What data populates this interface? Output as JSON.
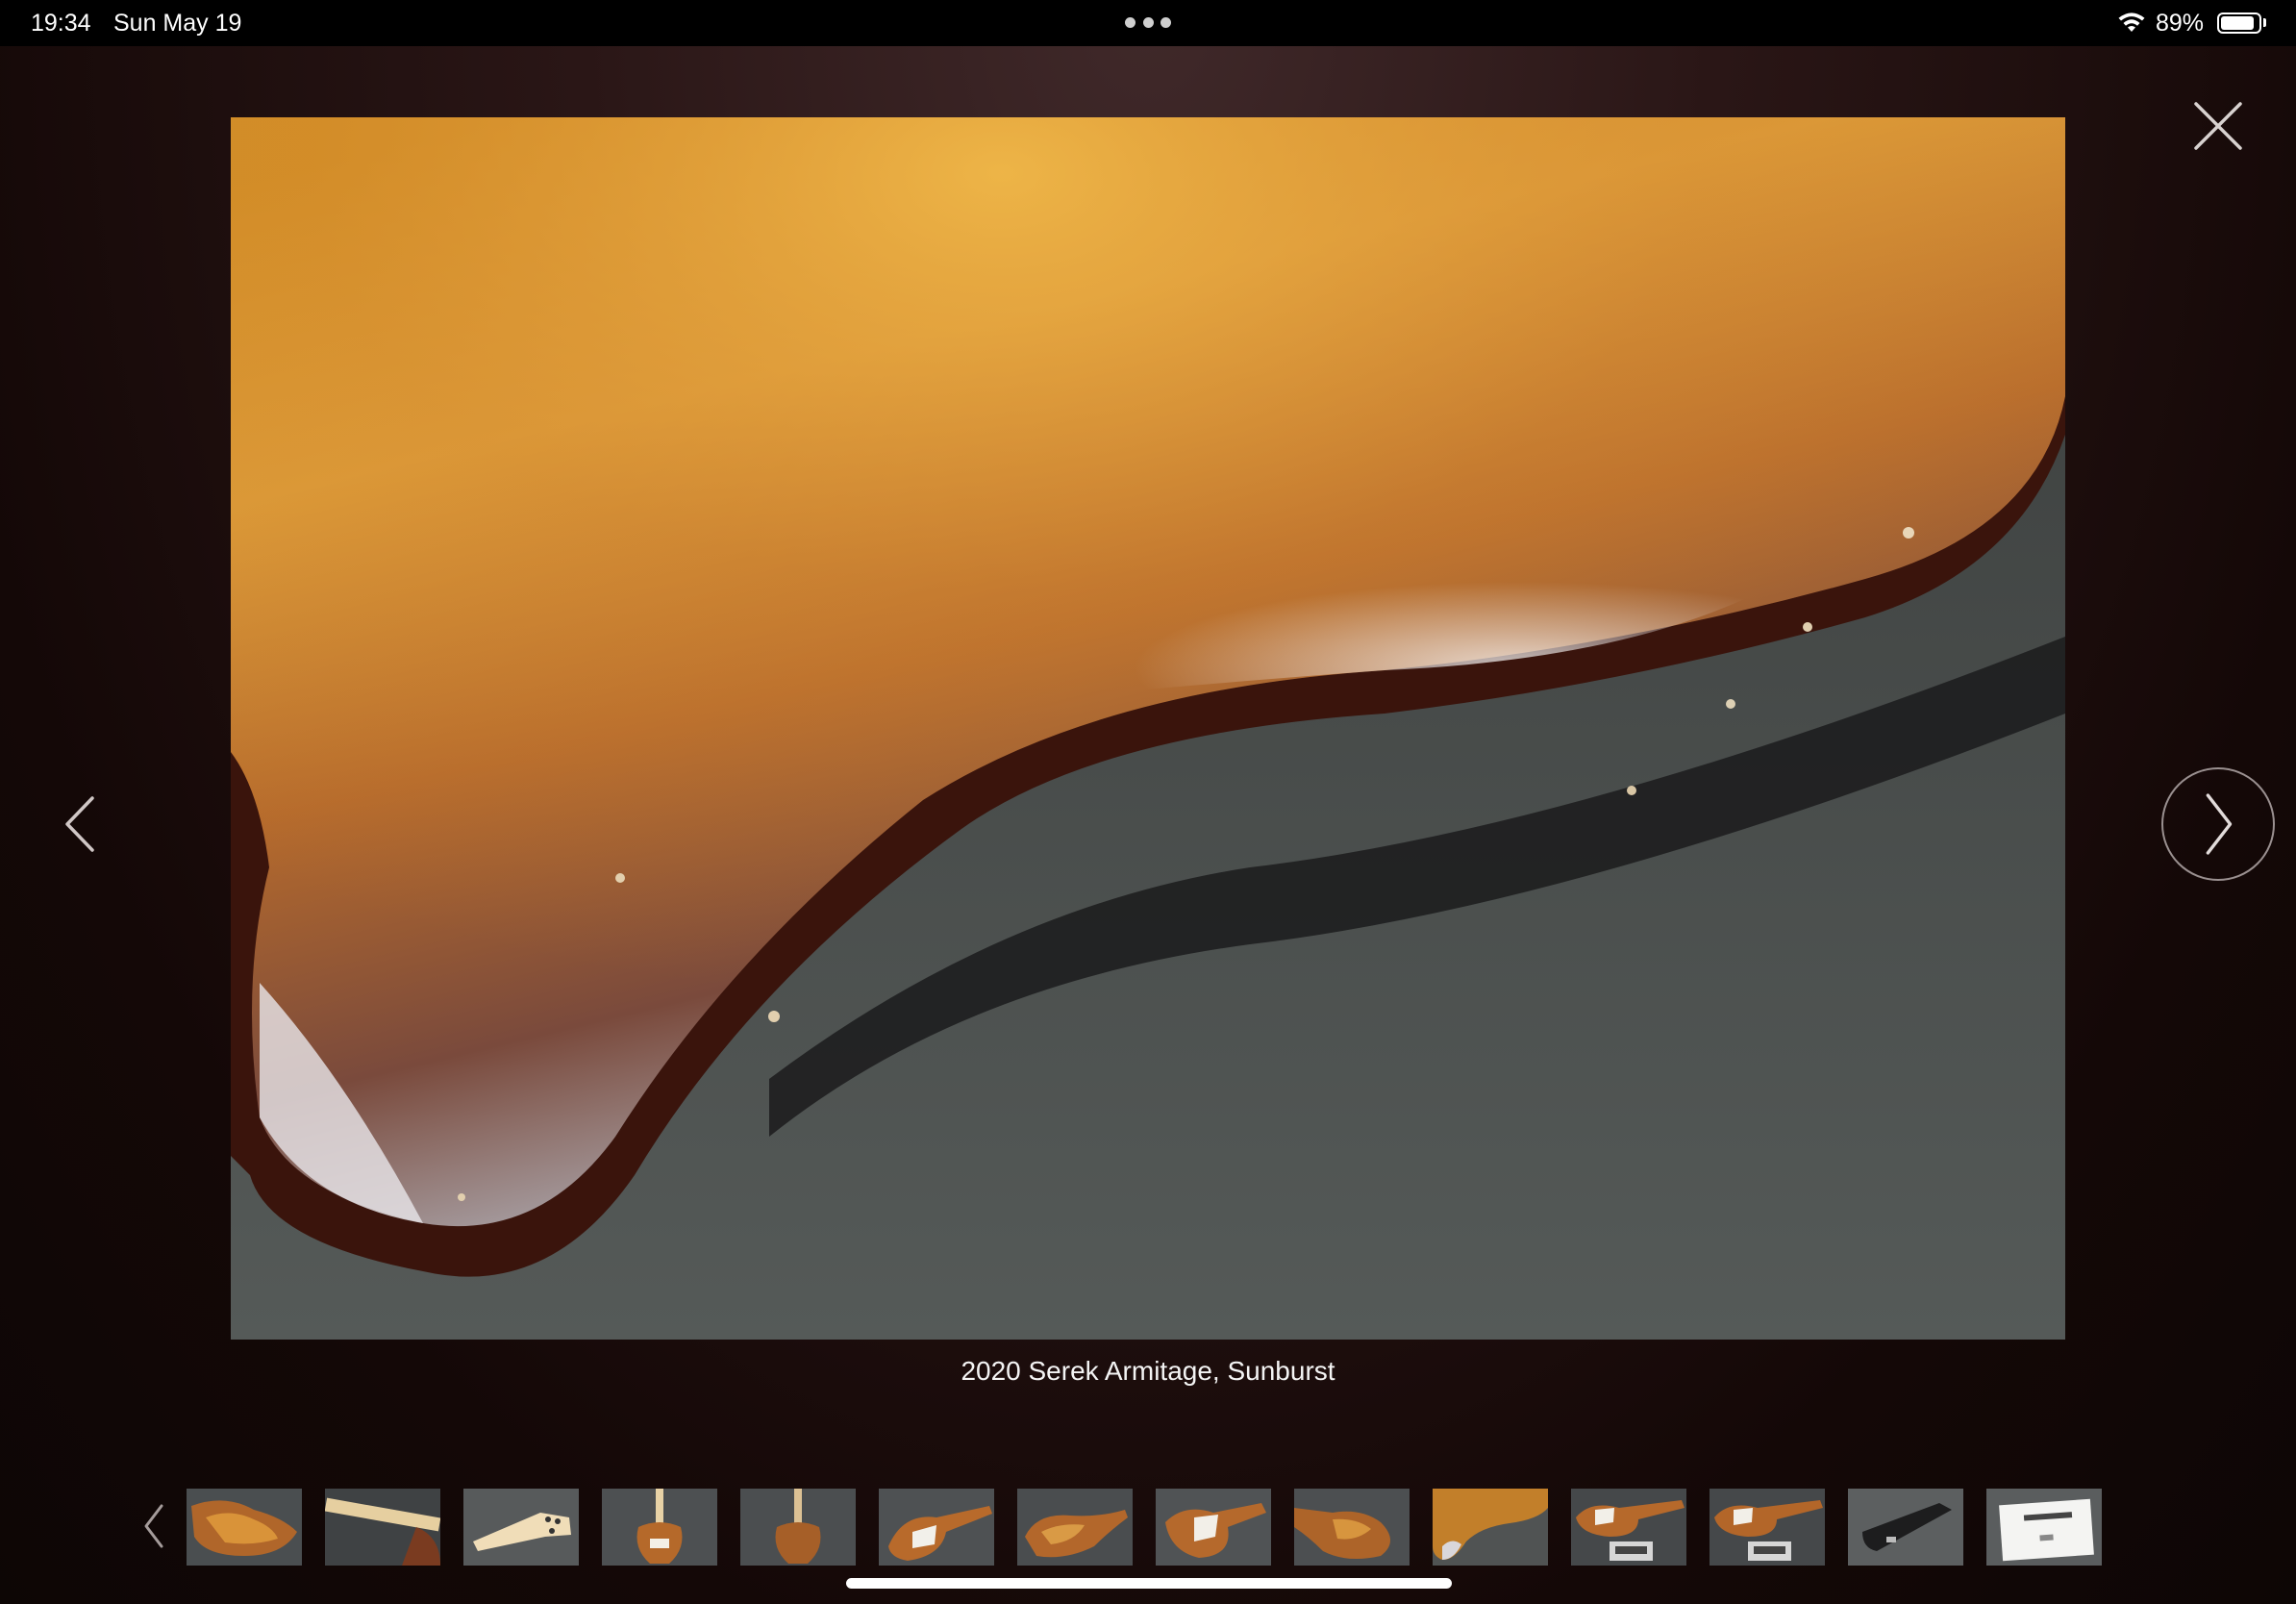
{
  "status_bar": {
    "time": "19:34",
    "date": "Sun May 19",
    "battery_text": "89%",
    "battery_level": 0.89
  },
  "viewer": {
    "caption": "2020 Serek Armitage, Sunburst",
    "close_icon": "close-icon",
    "prev_icon": "chevron-left-icon",
    "next_icon": "chevron-right-icon"
  },
  "thumbnails": {
    "count": 14,
    "selected_index": 9,
    "items": [
      {
        "kind": "body-back"
      },
      {
        "kind": "neck-back"
      },
      {
        "kind": "headstock"
      },
      {
        "kind": "front-full"
      },
      {
        "kind": "back-full"
      },
      {
        "kind": "front-angle"
      },
      {
        "kind": "body-angle"
      },
      {
        "kind": "front-top"
      },
      {
        "kind": "body-side"
      },
      {
        "kind": "body-closeup"
      },
      {
        "kind": "scale-1"
      },
      {
        "kind": "scale-2"
      },
      {
        "kind": "case"
      },
      {
        "kind": "certificate"
      }
    ]
  },
  "colors": {
    "background": "#1e0f0e",
    "accent": "#ffffff"
  }
}
